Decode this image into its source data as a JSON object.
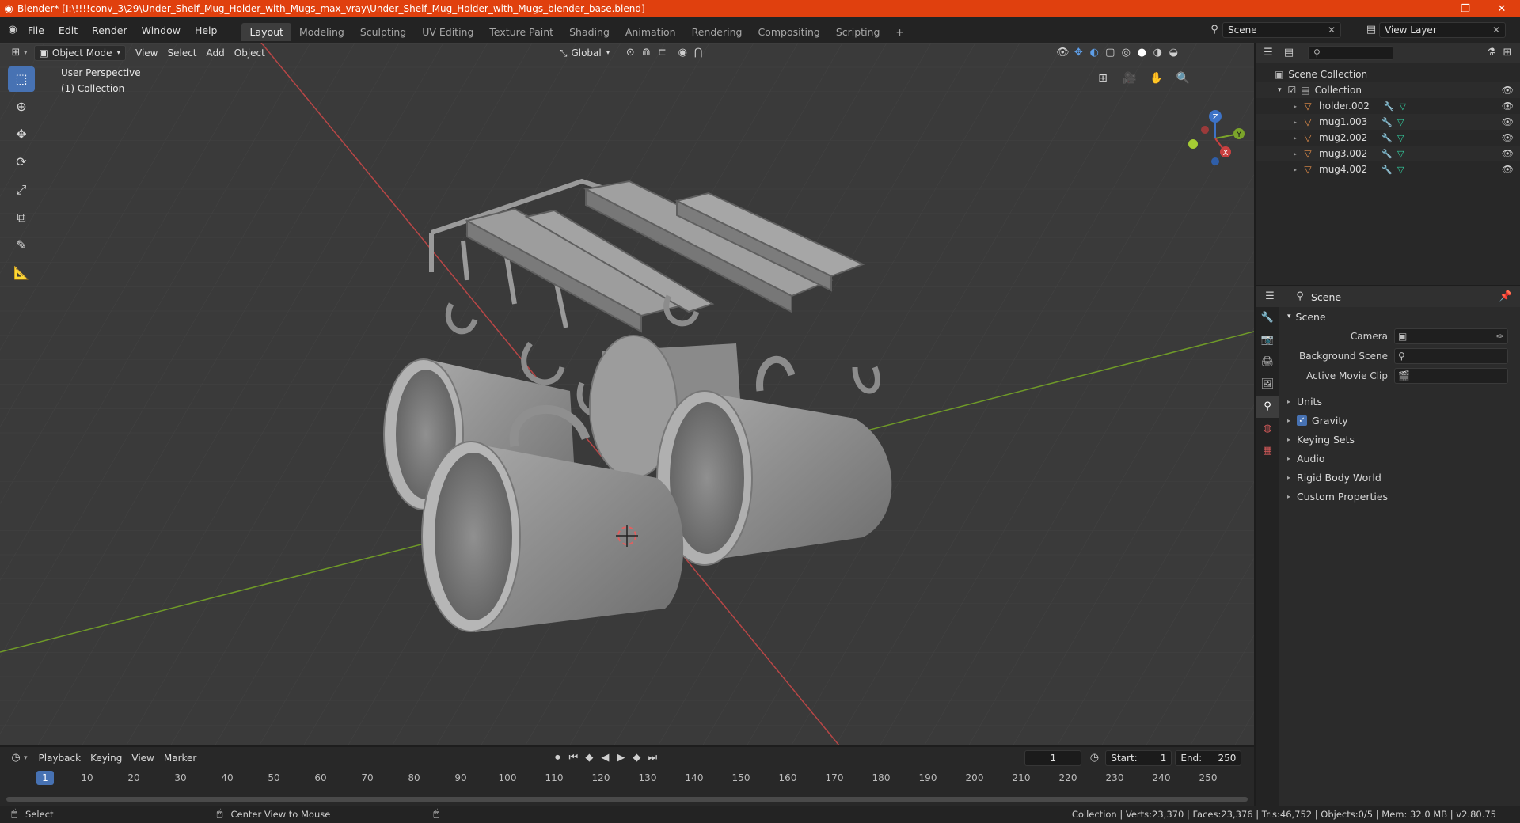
{
  "titlebar": {
    "title": "Blender* [I:\\!!!!conv_3\\29\\Under_Shelf_Mug_Holder_with_Mugs_max_vray\\Under_Shelf_Mug_Holder_with_Mugs_blender_base.blend]",
    "minimize": "–",
    "maximize": "❐",
    "close": "✕"
  },
  "menu": [
    "File",
    "Edit",
    "Render",
    "Window",
    "Help"
  ],
  "workspaces": [
    "Layout",
    "Modeling",
    "Sculpting",
    "UV Editing",
    "Texture Paint",
    "Shading",
    "Animation",
    "Rendering",
    "Compositing",
    "Scripting"
  ],
  "active_workspace": "Layout",
  "add_workspace": "+",
  "scene_selector": "Scene",
  "view_layer": "View Layer",
  "viewport": {
    "mode": "Object Mode",
    "menus": [
      "View",
      "Select",
      "Add",
      "Object"
    ],
    "transform_orientation": "Global",
    "overlay_title": "User Perspective",
    "overlay_collection": "(1) Collection",
    "gizmo": {
      "z": "Z",
      "y": "Y",
      "x": "X"
    }
  },
  "outliner": {
    "root": "Scene Collection",
    "collection": "Collection",
    "objects": [
      "holder.002",
      "mug1.003",
      "mug2.002",
      "mug3.002",
      "mug4.002"
    ]
  },
  "properties": {
    "context": "Scene",
    "panel": "Scene",
    "fields": [
      {
        "label": "Camera",
        "value": ""
      },
      {
        "label": "Background Scene",
        "value": ""
      },
      {
        "label": "Active Movie Clip",
        "value": ""
      }
    ],
    "subpanels": [
      "Units",
      "Gravity",
      "Keying Sets",
      "Audio",
      "Rigid Body World",
      "Custom Properties"
    ],
    "gravity_checked": true
  },
  "timeline": {
    "menus": [
      "Playback",
      "Keying",
      "View",
      "Marker"
    ],
    "current_frame": "1",
    "start_label": "Start:",
    "start": "1",
    "end_label": "End:",
    "end": "250",
    "ruler": [
      "1",
      "10",
      "20",
      "30",
      "40",
      "50",
      "60",
      "70",
      "80",
      "90",
      "100",
      "110",
      "120",
      "130",
      "140",
      "150",
      "160",
      "170",
      "180",
      "190",
      "200",
      "210",
      "220",
      "230",
      "240",
      "250"
    ]
  },
  "statusbar": {
    "select": "Select",
    "center_view": "Center View to Mouse",
    "stats": "Collection | Verts:23,370 | Faces:23,376 | Tris:46,752 | Objects:0/5 | Mem: 32.0 MB | v2.80.75"
  },
  "colors": {
    "titlebar": "#e0400e",
    "accent": "#4772b3",
    "x_axis": "#c94040",
    "y_axis": "#7ba42a",
    "mesh_icon": "#e8904a"
  }
}
